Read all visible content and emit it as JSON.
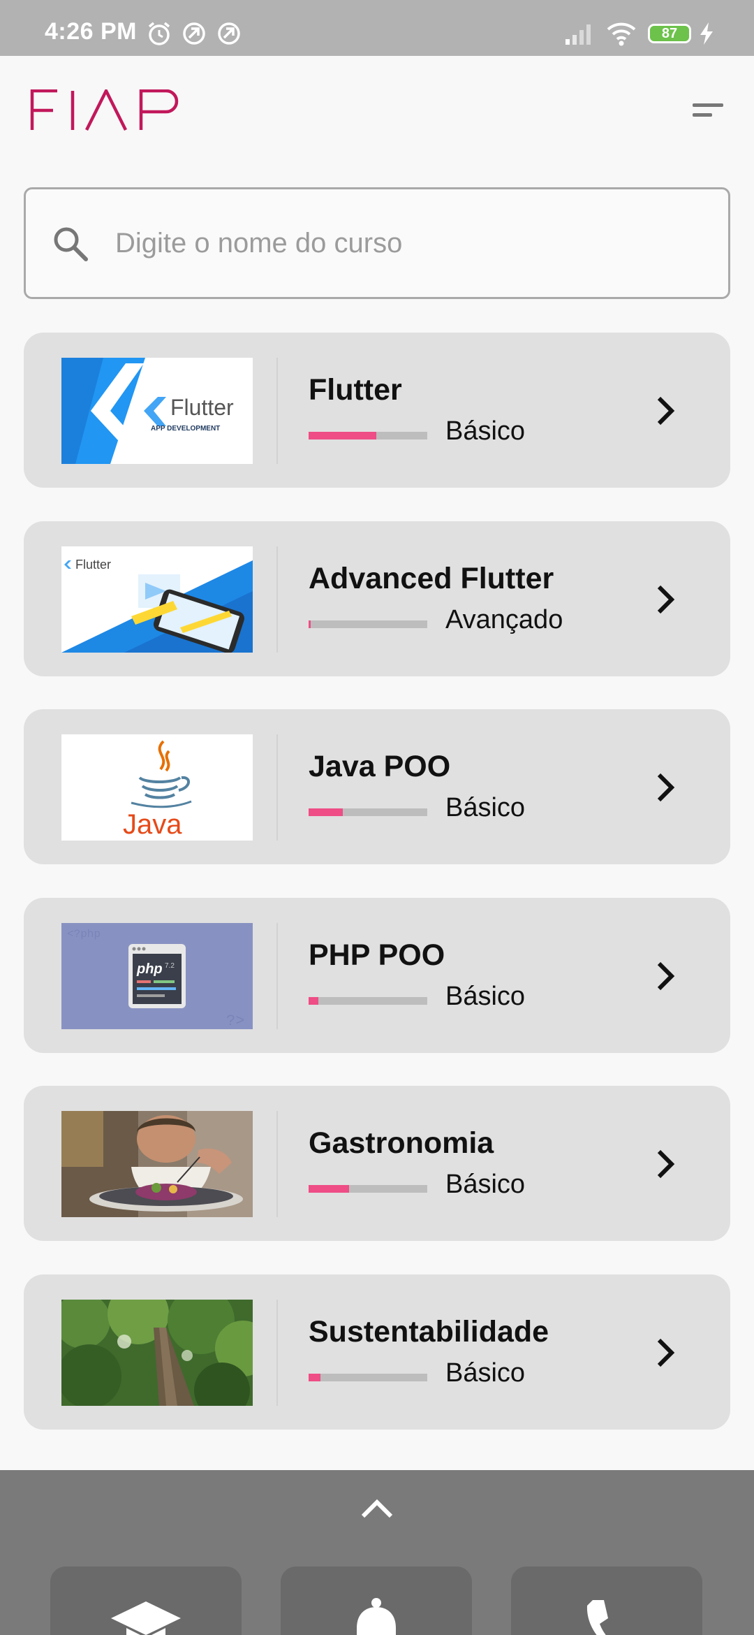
{
  "status_bar": {
    "time": "4:26 PM",
    "battery": "87",
    "icons": [
      "alarm-icon",
      "sync-icon",
      "sync-icon",
      "signal-icon",
      "wifi-icon",
      "battery-icon",
      "charging-icon"
    ]
  },
  "header": {
    "logo_text": "FIAP",
    "menu_icon": "menu-icon"
  },
  "search": {
    "placeholder": "Digite o nome do curso",
    "value": ""
  },
  "courses": [
    {
      "title": "Flutter",
      "level": "Básico",
      "progress": 0.57,
      "image": "flutter-app-development-image"
    },
    {
      "title": "Advanced Flutter",
      "level": "Avançado",
      "progress": 0.02,
      "image": "flutter-phone-image"
    },
    {
      "title": "Java POO",
      "level": "Básico",
      "progress": 0.29,
      "image": "java-logo-image"
    },
    {
      "title": "PHP POO",
      "level": "Básico",
      "progress": 0.08,
      "image": "php-code-window-image"
    },
    {
      "title": "Gastronomia",
      "level": "Básico",
      "progress": 0.34,
      "image": "chef-plating-image"
    },
    {
      "title": "Sustentabilidade",
      "level": "Básico",
      "progress": 0.1,
      "image": "forest-tree-image"
    }
  ],
  "bottom_nav": {
    "expand_icon": "chevron-up-icon",
    "items": [
      "graduation-cap-icon",
      "bell-icon",
      "phone-icon"
    ]
  },
  "colors": {
    "brand": "#c2185b",
    "progress_fill": "#ee4d86",
    "progress_track": "#bdbdbd",
    "card_bg": "#e0e0e0",
    "bottom_panel": "#7a7a7a"
  }
}
